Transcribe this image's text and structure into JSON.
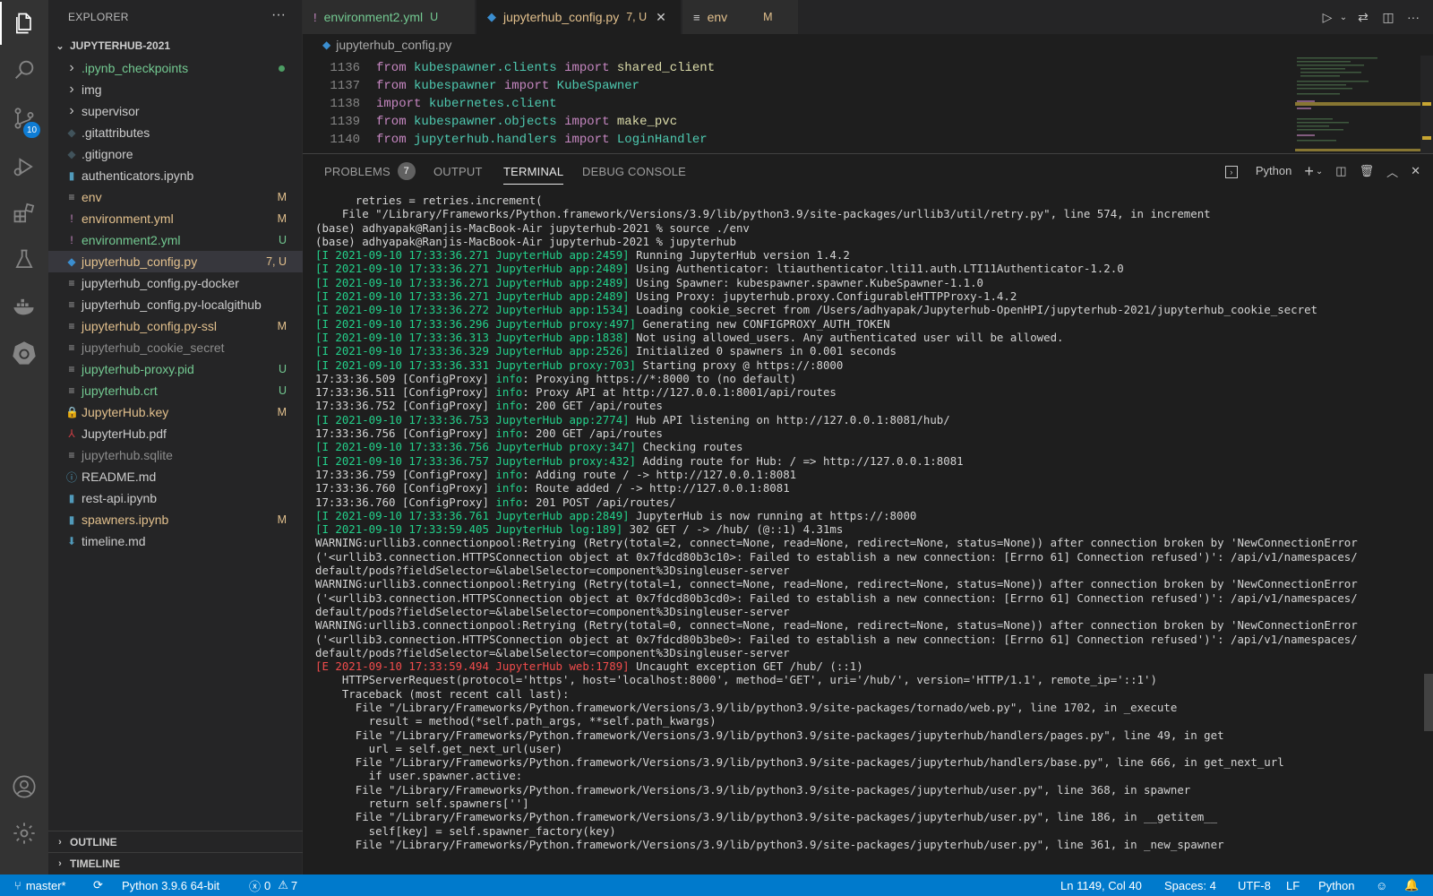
{
  "activity": {
    "scm_badge": "10"
  },
  "explorer": {
    "title": "EXPLORER",
    "more": "···",
    "root": "JUPYTERHUB-2021",
    "files": [
      {
        "name": ".ipynb_checkpoints",
        "icon": "chevron-right",
        "color": "#73c991",
        "badge": "",
        "dot": true
      },
      {
        "name": "img",
        "icon": "chevron-right",
        "color": "#cccccc",
        "badge": ""
      },
      {
        "name": "supervisor",
        "icon": "chevron-right",
        "color": "#cccccc",
        "badge": ""
      },
      {
        "name": ".gitattributes",
        "icon": "git-diamond",
        "color": "#cccccc",
        "badge": ""
      },
      {
        "name": ".gitignore",
        "icon": "git-diamond",
        "color": "#cccccc",
        "badge": ""
      },
      {
        "name": "authenticators.ipynb",
        "icon": "notebook",
        "color": "#cccccc",
        "badge": ""
      },
      {
        "name": "env",
        "icon": "lines",
        "color": "#e2c08d",
        "badge": "M"
      },
      {
        "name": "environment.yml",
        "icon": "yaml",
        "color": "#e2c08d",
        "badge": "M"
      },
      {
        "name": "environment2.yml",
        "icon": "yaml",
        "color": "#73c991",
        "badge": "U"
      },
      {
        "name": "jupyterhub_config.py",
        "icon": "python",
        "color": "#e2c08d",
        "badge": "7, U",
        "selected": true
      },
      {
        "name": "jupyterhub_config.py-docker",
        "icon": "lines",
        "color": "#cccccc",
        "badge": ""
      },
      {
        "name": "jupyterhub_config.py-localgithub",
        "icon": "lines",
        "color": "#cccccc",
        "badge": ""
      },
      {
        "name": "jupyterhub_config.py-ssl",
        "icon": "lines",
        "color": "#e2c08d",
        "badge": "M"
      },
      {
        "name": "jupyterhub_cookie_secret",
        "icon": "lines",
        "color": "#8c8c8c",
        "badge": ""
      },
      {
        "name": "jupyterhub-proxy.pid",
        "icon": "lines",
        "color": "#73c991",
        "badge": "U"
      },
      {
        "name": "jupyterhub.crt",
        "icon": "lines",
        "color": "#73c991",
        "badge": "U"
      },
      {
        "name": "JupyterHub.key",
        "icon": "lock",
        "color": "#e2c08d",
        "badge": "M"
      },
      {
        "name": "JupyterHub.pdf",
        "icon": "pdf",
        "color": "#cccccc",
        "badge": ""
      },
      {
        "name": "jupyterhub.sqlite",
        "icon": "lines",
        "color": "#8c8c8c",
        "badge": ""
      },
      {
        "name": "README.md",
        "icon": "info",
        "color": "#cccccc",
        "badge": ""
      },
      {
        "name": "rest-api.ipynb",
        "icon": "notebook",
        "color": "#cccccc",
        "badge": ""
      },
      {
        "name": "spawners.ipynb",
        "icon": "notebook",
        "color": "#e2c08d",
        "badge": "M"
      },
      {
        "name": "timeline.md",
        "icon": "markdown",
        "color": "#cccccc",
        "badge": ""
      }
    ],
    "outline": "OUTLINE",
    "timeline": "TIMELINE"
  },
  "tabs": [
    {
      "label": "environment2.yml",
      "badge": "U",
      "icon": "!",
      "icon_color": "#c586c0",
      "color": "#73c991"
    },
    {
      "label": "jupyterhub_config.py",
      "badge": "7, U",
      "icon": "py",
      "icon_color": "#3b8ed0",
      "color": "#e2c08d",
      "active": true,
      "close": "✕"
    },
    {
      "label": "env",
      "badge": "M",
      "icon": "≡",
      "icon_color": "#cccccc",
      "color": "#e2c08d"
    }
  ],
  "breadcrumb": "jupyterhub_config.py",
  "editor": {
    "lines": [
      {
        "n": "1136",
        "t": [
          [
            "kw",
            "from"
          ],
          [
            "txt",
            " "
          ],
          [
            "mod",
            "kubespawner.clients"
          ],
          [
            "txt",
            " "
          ],
          [
            "kw",
            "import"
          ],
          [
            "txt",
            " "
          ],
          [
            "fn",
            "shared_client"
          ]
        ]
      },
      {
        "n": "1137",
        "t": [
          [
            "kw",
            "from"
          ],
          [
            "txt",
            " "
          ],
          [
            "mod",
            "kubespawner"
          ],
          [
            "txt",
            " "
          ],
          [
            "kw",
            "import"
          ],
          [
            "txt",
            " "
          ],
          [
            "mod",
            "KubeSpawner"
          ]
        ]
      },
      {
        "n": "1138",
        "t": [
          [
            "kw",
            "import"
          ],
          [
            "txt",
            " "
          ],
          [
            "mod",
            "kubernetes.client"
          ]
        ]
      },
      {
        "n": "1139",
        "t": [
          [
            "kw",
            "from"
          ],
          [
            "txt",
            " "
          ],
          [
            "mod",
            "kubespawner.objects"
          ],
          [
            "txt",
            " "
          ],
          [
            "kw",
            "import"
          ],
          [
            "txt",
            " "
          ],
          [
            "fn",
            "make_pvc"
          ]
        ]
      },
      {
        "n": "1140",
        "t": [
          [
            "kw",
            "from"
          ],
          [
            "txt",
            " "
          ],
          [
            "mod",
            "jupyterhub.handlers"
          ],
          [
            "txt",
            " "
          ],
          [
            "kw",
            "import"
          ],
          [
            "txt",
            " "
          ],
          [
            "mod",
            "LoginHandler"
          ]
        ]
      }
    ]
  },
  "panel": {
    "tabs": {
      "problems": "PROBLEMS",
      "problems_count": "7",
      "output": "OUTPUT",
      "terminal": "TERMINAL",
      "debug": "DEBUG CONSOLE"
    },
    "shell": "Python"
  },
  "terminal": [
    [
      [
        "",
        "      retries = retries.increment("
      ]
    ],
    [
      [
        "",
        "    File \"/Library/Frameworks/Python.framework/Versions/3.9/lib/python3.9/site-packages/urllib3/util/retry.py\", line 574, in increment"
      ]
    ],
    [
      [
        "",
        "(base) adhyapak@Ranjis-MacBook-Air jupyterhub-2021 % source ./env"
      ]
    ],
    [
      [
        "",
        "(base) adhyapak@Ranjis-MacBook-Air jupyterhub-2021 % jupyterhub"
      ]
    ],
    [
      [
        "g",
        "[I 2021-09-10 17:33:36.271 JupyterHub app:2459]"
      ],
      [
        "",
        " Running JupyterHub version 1.4.2"
      ]
    ],
    [
      [
        "g",
        "[I 2021-09-10 17:33:36.271 JupyterHub app:2489]"
      ],
      [
        "",
        " Using Authenticator: ltiauthenticator.lti11.auth.LTI11Authenticator-1.2.0"
      ]
    ],
    [
      [
        "g",
        "[I 2021-09-10 17:33:36.271 JupyterHub app:2489]"
      ],
      [
        "",
        " Using Spawner: kubespawner.spawner.KubeSpawner-1.1.0"
      ]
    ],
    [
      [
        "g",
        "[I 2021-09-10 17:33:36.271 JupyterHub app:2489]"
      ],
      [
        "",
        " Using Proxy: jupyterhub.proxy.ConfigurableHTTPProxy-1.4.2"
      ]
    ],
    [
      [
        "g",
        "[I 2021-09-10 17:33:36.272 JupyterHub app:1534]"
      ],
      [
        "",
        " Loading cookie_secret from /Users/adhyapak/Jupyterhub-OpenHPI/jupyterhub-2021/jupyterhub_cookie_secret"
      ]
    ],
    [
      [
        "g",
        "[I 2021-09-10 17:33:36.296 JupyterHub proxy:497]"
      ],
      [
        "",
        " Generating new CONFIGPROXY_AUTH_TOKEN"
      ]
    ],
    [
      [
        "g",
        "[I 2021-09-10 17:33:36.313 JupyterHub app:1838]"
      ],
      [
        "",
        " Not using allowed_users. Any authenticated user will be allowed."
      ]
    ],
    [
      [
        "g",
        "[I 2021-09-10 17:33:36.329 JupyterHub app:2526]"
      ],
      [
        "",
        " Initialized 0 spawners in 0.001 seconds"
      ]
    ],
    [
      [
        "g",
        "[I 2021-09-10 17:33:36.331 JupyterHub proxy:703]"
      ],
      [
        "",
        " Starting proxy @ https://:8000"
      ]
    ],
    [
      [
        "",
        "17:33:36.509 [ConfigProxy] "
      ],
      [
        "g",
        "info"
      ],
      [
        "",
        ": Proxying https://*:8000 to (no default)"
      ]
    ],
    [
      [
        "",
        "17:33:36.511 [ConfigProxy] "
      ],
      [
        "g",
        "info"
      ],
      [
        "",
        ": Proxy API at http://127.0.0.1:8001/api/routes"
      ]
    ],
    [
      [
        "",
        "17:33:36.752 [ConfigProxy] "
      ],
      [
        "g",
        "info"
      ],
      [
        "",
        ": 200 GET /api/routes"
      ]
    ],
    [
      [
        "g",
        "[I 2021-09-10 17:33:36.753 JupyterHub app:2774]"
      ],
      [
        "",
        " Hub API listening on http://127.0.0.1:8081/hub/"
      ]
    ],
    [
      [
        "",
        "17:33:36.756 [ConfigProxy] "
      ],
      [
        "g",
        "info"
      ],
      [
        "",
        ": 200 GET /api/routes"
      ]
    ],
    [
      [
        "g",
        "[I 2021-09-10 17:33:36.756 JupyterHub proxy:347]"
      ],
      [
        "",
        " Checking routes"
      ]
    ],
    [
      [
        "g",
        "[I 2021-09-10 17:33:36.757 JupyterHub proxy:432]"
      ],
      [
        "",
        " Adding route for Hub: / => http://127.0.0.1:8081"
      ]
    ],
    [
      [
        "",
        "17:33:36.759 [ConfigProxy] "
      ],
      [
        "g",
        "info"
      ],
      [
        "",
        ": Adding route / -> http://127.0.0.1:8081"
      ]
    ],
    [
      [
        "",
        "17:33:36.760 [ConfigProxy] "
      ],
      [
        "g",
        "info"
      ],
      [
        "",
        ": Route added / -> http://127.0.0.1:8081"
      ]
    ],
    [
      [
        "",
        "17:33:36.760 [ConfigProxy] "
      ],
      [
        "g",
        "info"
      ],
      [
        "",
        ": 201 POST /api/routes/"
      ]
    ],
    [
      [
        "g",
        "[I 2021-09-10 17:33:36.761 JupyterHub app:2849]"
      ],
      [
        "",
        " JupyterHub is now running at https://:8000"
      ]
    ],
    [
      [
        "g",
        "[I 2021-09-10 17:33:59.405 JupyterHub log:189]"
      ],
      [
        "",
        " 302 GET / -> /hub/ (@::1) 4.31ms"
      ]
    ],
    [
      [
        "",
        "WARNING:urllib3.connectionpool:Retrying (Retry(total=2, connect=None, read=None, redirect=None, status=None)) after connection broken by 'NewConnectionError"
      ]
    ],
    [
      [
        "",
        "('<urllib3.connection.HTTPSConnection object at 0x7fdcd80b3c10>: Failed to establish a new connection: [Errno 61] Connection refused')': /api/v1/namespaces/"
      ]
    ],
    [
      [
        "",
        "default/pods?fieldSelector=&labelSelector=component%3Dsingleuser-server"
      ]
    ],
    [
      [
        "",
        "WARNING:urllib3.connectionpool:Retrying (Retry(total=1, connect=None, read=None, redirect=None, status=None)) after connection broken by 'NewConnectionError"
      ]
    ],
    [
      [
        "",
        "('<urllib3.connection.HTTPSConnection object at 0x7fdcd80b3cd0>: Failed to establish a new connection: [Errno 61] Connection refused')': /api/v1/namespaces/"
      ]
    ],
    [
      [
        "",
        "default/pods?fieldSelector=&labelSelector=component%3Dsingleuser-server"
      ]
    ],
    [
      [
        "",
        "WARNING:urllib3.connectionpool:Retrying (Retry(total=0, connect=None, read=None, redirect=None, status=None)) after connection broken by 'NewConnectionError"
      ]
    ],
    [
      [
        "",
        "('<urllib3.connection.HTTPSConnection object at 0x7fdcd80b3be0>: Failed to establish a new connection: [Errno 61] Connection refused')': /api/v1/namespaces/"
      ]
    ],
    [
      [
        "",
        "default/pods?fieldSelector=&labelSelector=component%3Dsingleuser-server"
      ]
    ],
    [
      [
        "r",
        "[E 2021-09-10 17:33:59.494 JupyterHub web:1789]"
      ],
      [
        "",
        " Uncaught exception GET /hub/ (::1)"
      ]
    ],
    [
      [
        "",
        "    HTTPServerRequest(protocol='https', host='localhost:8000', method='GET', uri='/hub/', version='HTTP/1.1', remote_ip='::1')"
      ]
    ],
    [
      [
        "",
        "    Traceback (most recent call last):"
      ]
    ],
    [
      [
        "",
        "      File \"/Library/Frameworks/Python.framework/Versions/3.9/lib/python3.9/site-packages/tornado/web.py\", line 1702, in _execute"
      ]
    ],
    [
      [
        "",
        "        result = method(*self.path_args, **self.path_kwargs)"
      ]
    ],
    [
      [
        "",
        "      File \"/Library/Frameworks/Python.framework/Versions/3.9/lib/python3.9/site-packages/jupyterhub/handlers/pages.py\", line 49, in get"
      ]
    ],
    [
      [
        "",
        "        url = self.get_next_url(user)"
      ]
    ],
    [
      [
        "",
        "      File \"/Library/Frameworks/Python.framework/Versions/3.9/lib/python3.9/site-packages/jupyterhub/handlers/base.py\", line 666, in get_next_url"
      ]
    ],
    [
      [
        "",
        "        if user.spawner.active:"
      ]
    ],
    [
      [
        "",
        "      File \"/Library/Frameworks/Python.framework/Versions/3.9/lib/python3.9/site-packages/jupyterhub/user.py\", line 368, in spawner"
      ]
    ],
    [
      [
        "",
        "        return self.spawners['']"
      ]
    ],
    [
      [
        "",
        "      File \"/Library/Frameworks/Python.framework/Versions/3.9/lib/python3.9/site-packages/jupyterhub/user.py\", line 186, in __getitem__"
      ]
    ],
    [
      [
        "",
        "        self[key] = self.spawner_factory(key)"
      ]
    ],
    [
      [
        "",
        "      File \"/Library/Frameworks/Python.framework/Versions/3.9/lib/python3.9/site-packages/jupyterhub/user.py\", line 361, in _new_spawner"
      ]
    ]
  ],
  "status": {
    "branch": "master*",
    "interpreter": "Python 3.9.6 64-bit",
    "errors": "0",
    "warnings": "7",
    "position": "Ln 1149, Col 40",
    "spaces": "Spaces: 4",
    "encoding": "UTF-8",
    "eol": "LF",
    "language": "Python"
  }
}
